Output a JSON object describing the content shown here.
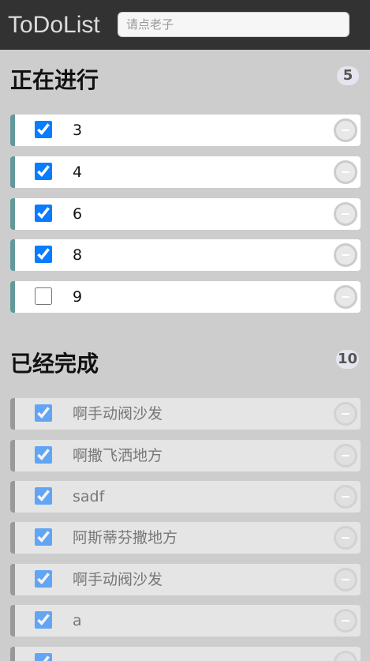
{
  "header": {
    "title": "ToDoList",
    "search_placeholder": "请点老子"
  },
  "doing": {
    "title": "正在进行",
    "count": "5",
    "items": [
      {
        "text": "3",
        "checked": true
      },
      {
        "text": "4",
        "checked": true
      },
      {
        "text": "6",
        "checked": true
      },
      {
        "text": "8",
        "checked": true
      },
      {
        "text": "9",
        "checked": false
      }
    ]
  },
  "done": {
    "title": "已经完成",
    "count": "10",
    "items": [
      {
        "text": "啊手动阀沙发",
        "checked": true
      },
      {
        "text": "啊撒飞洒地方",
        "checked": true
      },
      {
        "text": "sadf",
        "checked": true
      },
      {
        "text": "阿斯蒂芬撒地方",
        "checked": true
      },
      {
        "text": "啊手动阀沙发",
        "checked": true
      },
      {
        "text": "a",
        "checked": true
      },
      {
        "text": "",
        "checked": true
      }
    ]
  },
  "colors": {
    "header_bg": "#323232",
    "page_bg": "#cdcdcd",
    "doing_accent": "#629a9c",
    "done_accent": "#999999"
  }
}
